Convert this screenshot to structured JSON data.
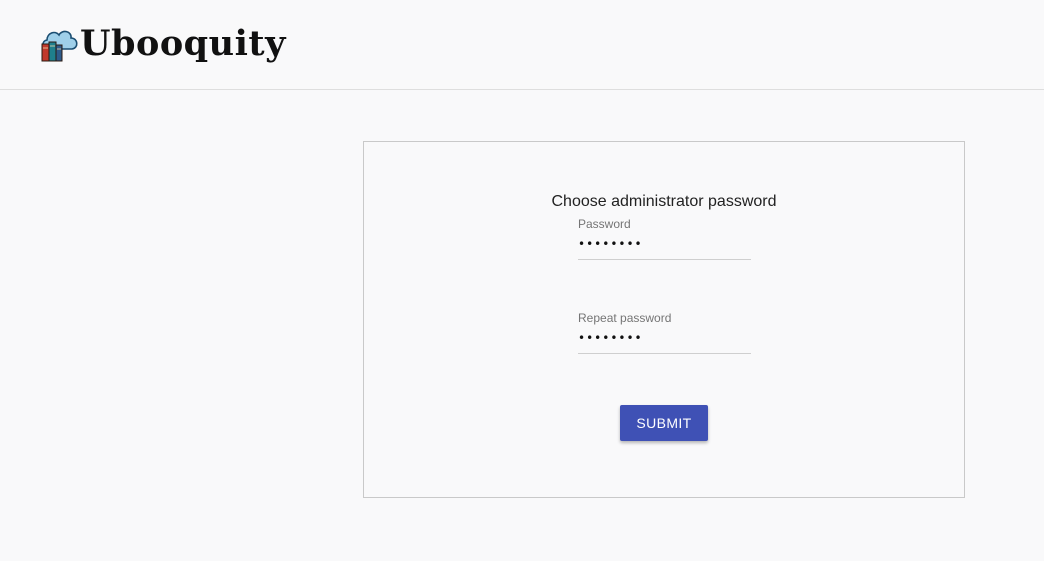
{
  "header": {
    "logo_text": "Ubooquity"
  },
  "form": {
    "title": "Choose administrator password",
    "password_label": "Password",
    "password_value": "********",
    "repeat_label": "Repeat password",
    "repeat_value": "********",
    "submit_label": "SUBMIT"
  },
  "colors": {
    "accent": "#3f51b5",
    "background": "#f9f9fa"
  },
  "icons": {
    "logo": "cloud-books-icon"
  }
}
